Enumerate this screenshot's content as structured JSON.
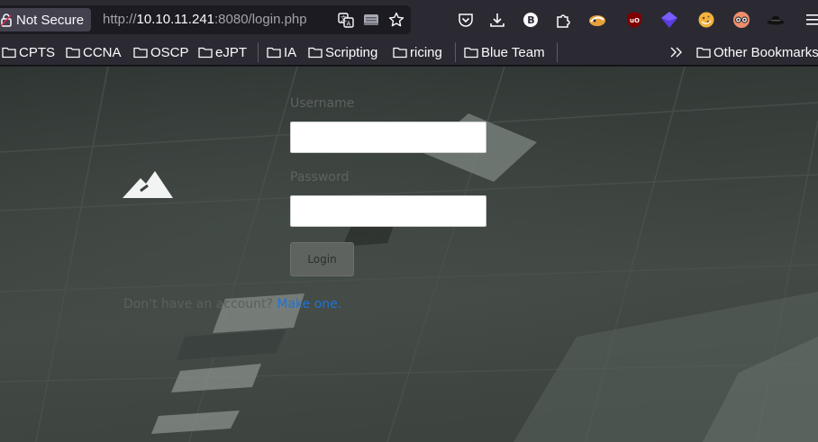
{
  "browser": {
    "security_label": "Not Secure",
    "url": {
      "scheme": "http://",
      "host": "10.10.11.241",
      "rest": ":8080/login.php"
    },
    "url_icons": [
      "translate-icon",
      "reader-view-icon",
      "bookmark-star-icon"
    ],
    "toolbar_icons": [
      "pocket-icon",
      "download-icon",
      "extension-b-icon",
      "extensions-puzzle-icon",
      "foxyproxy-icon",
      "ublock-origin-icon",
      "vpn-extension-icon",
      "cookie-extension-icon",
      "dark-reader-icon",
      "wappalyzer-hat-icon",
      "hamburger-menu-icon"
    ]
  },
  "bookmarks": {
    "items": [
      "CPTS",
      "CCNA",
      "OSCP",
      "eJPT",
      "IA",
      "Scripting",
      "ricing",
      "Blue Team"
    ],
    "overflow_label": "Other Bookmarks"
  },
  "login": {
    "username_label": "Username",
    "password_label": "Password",
    "username_value": "",
    "password_value": "",
    "button_label": "Login",
    "signup_text": "Don't have an account?",
    "signup_link": "Make one."
  },
  "colors": {
    "accent_link": "#1f72d6",
    "toolbar_bg": "#2b2a33",
    "url_field_bg": "#1c1b22"
  }
}
